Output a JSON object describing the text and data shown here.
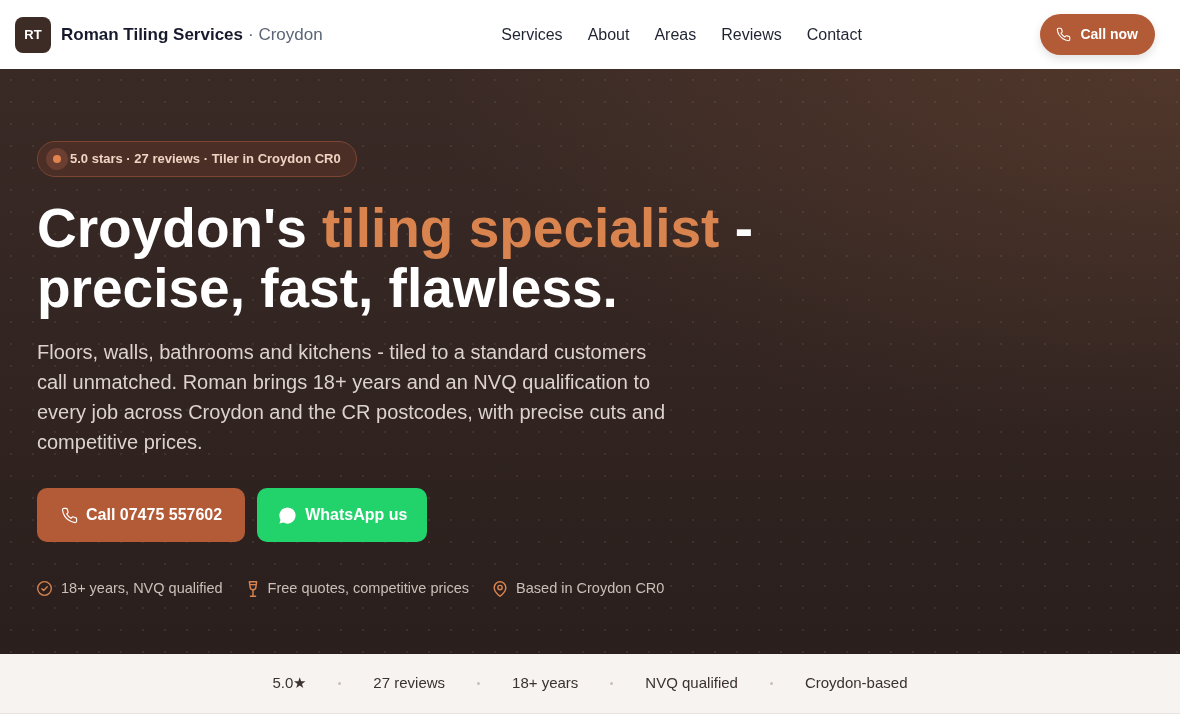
{
  "header": {
    "logo": "RT",
    "brand": "Roman Tiling Services",
    "location": "· Croydon",
    "nav": [
      "Services",
      "About",
      "Areas",
      "Reviews",
      "Contact"
    ],
    "call_button": "Call now"
  },
  "hero": {
    "badge": "5.0 stars · 27 reviews · Tiler in Croydon CR0",
    "heading": [
      {
        "text": "Croydon's ",
        "highlight": false
      },
      {
        "text": "tiling specialist",
        "highlight": true
      },
      {
        "text": " - precise, fast, flawless.",
        "highlight": false
      }
    ],
    "intro": "Floors, walls, bathrooms and kitchens - tiled to a standard customers call unmatched. Roman brings 18+ years and an NVQ qualification to every job across Croydon and the CR postcodes, with precise cuts and competitive prices.",
    "buttons": [
      {
        "kind": "call",
        "label": "Call 07475 557602"
      },
      {
        "kind": "whatsapp",
        "label": "WhatsApp us"
      }
    ],
    "features": [
      {
        "kind": "check",
        "label": "18+ years, NVQ qualified"
      },
      {
        "kind": "goblet",
        "label": "Free quotes, competitive prices"
      },
      {
        "kind": "pin",
        "label": "Based in Croydon CR0"
      }
    ]
  },
  "stats_bar": [
    "5.0★",
    "27 reviews",
    "18+ years",
    "NVQ qualified",
    "Croydon-based"
  ]
}
